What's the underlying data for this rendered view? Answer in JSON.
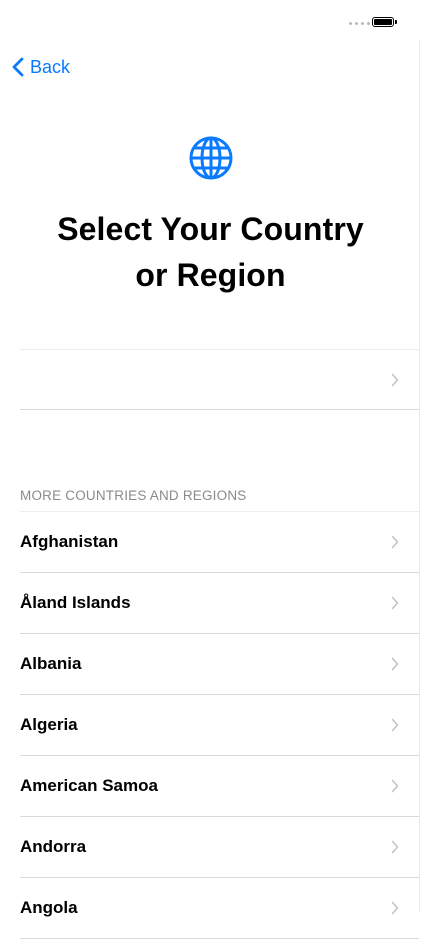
{
  "status_bar": {
    "signal_icon": "signal-dots-icon",
    "battery_icon": "battery-icon"
  },
  "nav": {
    "back_label": "Back",
    "back_icon": "chevron-left-icon",
    "accent_color": "#0a7aff"
  },
  "header": {
    "icon": "globe-icon",
    "title_line1": "Select Your Country",
    "title_line2": "or Region"
  },
  "suggested": {
    "label": ""
  },
  "section": {
    "title": "MORE COUNTRIES AND REGIONS"
  },
  "countries": [
    {
      "name": "Afghanistan"
    },
    {
      "name": "Åland Islands"
    },
    {
      "name": "Albania"
    },
    {
      "name": "Algeria"
    },
    {
      "name": "American Samoa"
    },
    {
      "name": "Andorra"
    },
    {
      "name": "Angola"
    }
  ],
  "colors": {
    "chevron": "#c4c4c7",
    "separator": "#d9d9dc",
    "section_text": "#8a8a8e"
  }
}
